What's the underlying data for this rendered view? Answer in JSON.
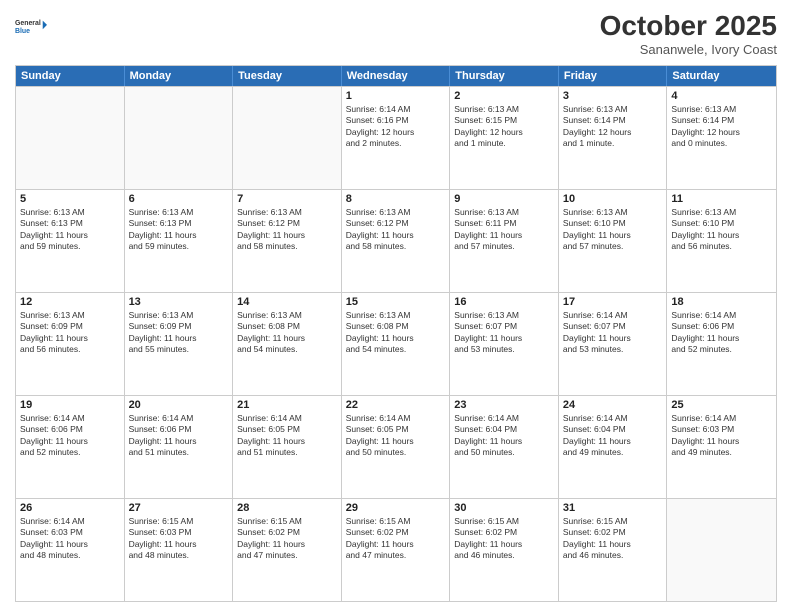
{
  "logo": {
    "line1": "General",
    "line2": "Blue"
  },
  "title": "October 2025",
  "subtitle": "Sananwele, Ivory Coast",
  "weekdays": [
    "Sunday",
    "Monday",
    "Tuesday",
    "Wednesday",
    "Thursday",
    "Friday",
    "Saturday"
  ],
  "weeks": [
    [
      {
        "day": "",
        "info": ""
      },
      {
        "day": "",
        "info": ""
      },
      {
        "day": "",
        "info": ""
      },
      {
        "day": "1",
        "info": "Sunrise: 6:14 AM\nSunset: 6:16 PM\nDaylight: 12 hours\nand 2 minutes."
      },
      {
        "day": "2",
        "info": "Sunrise: 6:13 AM\nSunset: 6:15 PM\nDaylight: 12 hours\nand 1 minute."
      },
      {
        "day": "3",
        "info": "Sunrise: 6:13 AM\nSunset: 6:14 PM\nDaylight: 12 hours\nand 1 minute."
      },
      {
        "day": "4",
        "info": "Sunrise: 6:13 AM\nSunset: 6:14 PM\nDaylight: 12 hours\nand 0 minutes."
      }
    ],
    [
      {
        "day": "5",
        "info": "Sunrise: 6:13 AM\nSunset: 6:13 PM\nDaylight: 11 hours\nand 59 minutes."
      },
      {
        "day": "6",
        "info": "Sunrise: 6:13 AM\nSunset: 6:13 PM\nDaylight: 11 hours\nand 59 minutes."
      },
      {
        "day": "7",
        "info": "Sunrise: 6:13 AM\nSunset: 6:12 PM\nDaylight: 11 hours\nand 58 minutes."
      },
      {
        "day": "8",
        "info": "Sunrise: 6:13 AM\nSunset: 6:12 PM\nDaylight: 11 hours\nand 58 minutes."
      },
      {
        "day": "9",
        "info": "Sunrise: 6:13 AM\nSunset: 6:11 PM\nDaylight: 11 hours\nand 57 minutes."
      },
      {
        "day": "10",
        "info": "Sunrise: 6:13 AM\nSunset: 6:10 PM\nDaylight: 11 hours\nand 57 minutes."
      },
      {
        "day": "11",
        "info": "Sunrise: 6:13 AM\nSunset: 6:10 PM\nDaylight: 11 hours\nand 56 minutes."
      }
    ],
    [
      {
        "day": "12",
        "info": "Sunrise: 6:13 AM\nSunset: 6:09 PM\nDaylight: 11 hours\nand 56 minutes."
      },
      {
        "day": "13",
        "info": "Sunrise: 6:13 AM\nSunset: 6:09 PM\nDaylight: 11 hours\nand 55 minutes."
      },
      {
        "day": "14",
        "info": "Sunrise: 6:13 AM\nSunset: 6:08 PM\nDaylight: 11 hours\nand 54 minutes."
      },
      {
        "day": "15",
        "info": "Sunrise: 6:13 AM\nSunset: 6:08 PM\nDaylight: 11 hours\nand 54 minutes."
      },
      {
        "day": "16",
        "info": "Sunrise: 6:13 AM\nSunset: 6:07 PM\nDaylight: 11 hours\nand 53 minutes."
      },
      {
        "day": "17",
        "info": "Sunrise: 6:14 AM\nSunset: 6:07 PM\nDaylight: 11 hours\nand 53 minutes."
      },
      {
        "day": "18",
        "info": "Sunrise: 6:14 AM\nSunset: 6:06 PM\nDaylight: 11 hours\nand 52 minutes."
      }
    ],
    [
      {
        "day": "19",
        "info": "Sunrise: 6:14 AM\nSunset: 6:06 PM\nDaylight: 11 hours\nand 52 minutes."
      },
      {
        "day": "20",
        "info": "Sunrise: 6:14 AM\nSunset: 6:06 PM\nDaylight: 11 hours\nand 51 minutes."
      },
      {
        "day": "21",
        "info": "Sunrise: 6:14 AM\nSunset: 6:05 PM\nDaylight: 11 hours\nand 51 minutes."
      },
      {
        "day": "22",
        "info": "Sunrise: 6:14 AM\nSunset: 6:05 PM\nDaylight: 11 hours\nand 50 minutes."
      },
      {
        "day": "23",
        "info": "Sunrise: 6:14 AM\nSunset: 6:04 PM\nDaylight: 11 hours\nand 50 minutes."
      },
      {
        "day": "24",
        "info": "Sunrise: 6:14 AM\nSunset: 6:04 PM\nDaylight: 11 hours\nand 49 minutes."
      },
      {
        "day": "25",
        "info": "Sunrise: 6:14 AM\nSunset: 6:03 PM\nDaylight: 11 hours\nand 49 minutes."
      }
    ],
    [
      {
        "day": "26",
        "info": "Sunrise: 6:14 AM\nSunset: 6:03 PM\nDaylight: 11 hours\nand 48 minutes."
      },
      {
        "day": "27",
        "info": "Sunrise: 6:15 AM\nSunset: 6:03 PM\nDaylight: 11 hours\nand 48 minutes."
      },
      {
        "day": "28",
        "info": "Sunrise: 6:15 AM\nSunset: 6:02 PM\nDaylight: 11 hours\nand 47 minutes."
      },
      {
        "day": "29",
        "info": "Sunrise: 6:15 AM\nSunset: 6:02 PM\nDaylight: 11 hours\nand 47 minutes."
      },
      {
        "day": "30",
        "info": "Sunrise: 6:15 AM\nSunset: 6:02 PM\nDaylight: 11 hours\nand 46 minutes."
      },
      {
        "day": "31",
        "info": "Sunrise: 6:15 AM\nSunset: 6:02 PM\nDaylight: 11 hours\nand 46 minutes."
      },
      {
        "day": "",
        "info": ""
      }
    ]
  ]
}
